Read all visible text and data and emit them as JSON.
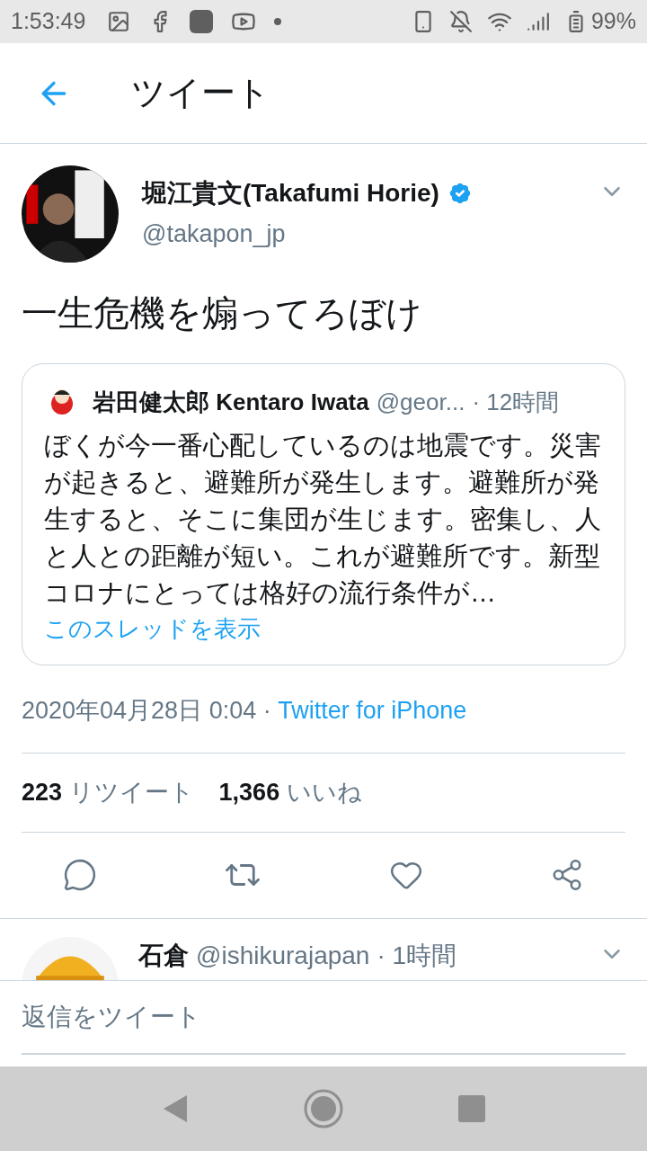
{
  "status_bar": {
    "time": "1:53:49",
    "battery": "99%"
  },
  "header": {
    "title": "ツイート"
  },
  "tweet": {
    "name": "堀江貴文(Takafumi Horie)",
    "handle": "@takapon_jp",
    "text": "一生危機を煽ってろぼけ",
    "quote": {
      "name": "岩田健太郎 Kentaro Iwata",
      "handle": "@geor...",
      "time": "· 12時間",
      "text": "ぼくが今一番心配しているのは地震です。災害が起きると、避難所が発生します。避難所が発生すると、そこに集団が生じます。密集し、人と人との距離が短い。これが避難所です。新型コロナにとっては格好の流行条件が…",
      "link": "このスレッドを表示"
    },
    "date": "2020年04月28日 0:04 · ",
    "source": "Twitter for iPhone",
    "stats": [
      {
        "count": "223",
        "label": "リツイート"
      },
      {
        "count": "1,366",
        "label": "いいね"
      }
    ]
  },
  "replies": [
    {
      "name": "石倉",
      "handle": "@ishikurajapan",
      "time": "· 1時間"
    }
  ],
  "reply_field": {
    "placeholder": "返信をツイート"
  }
}
